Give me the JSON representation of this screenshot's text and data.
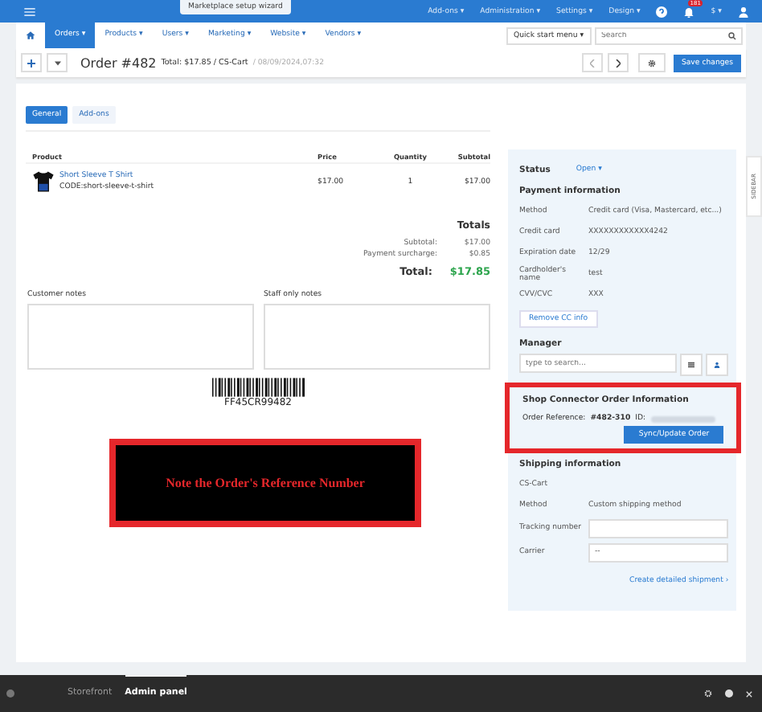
{
  "top_bar": {
    "wizard": "Marketplace setup wizard",
    "menus": [
      "Add-ons ▾",
      "Administration ▾",
      "Settings ▾",
      "Design ▾"
    ],
    "notifications": "181",
    "currency": "$ ▾"
  },
  "nav": {
    "items": [
      {
        "label": "Orders ▾",
        "selected": true
      },
      {
        "label": "Products ▾",
        "selected": false
      },
      {
        "label": "Users ▾",
        "selected": false
      },
      {
        "label": "Marketing ▾",
        "selected": false
      },
      {
        "label": "Website ▾",
        "selected": false
      },
      {
        "label": "Vendors ▾",
        "selected": false
      }
    ],
    "quick_menu": "Quick start menu ▾",
    "search": {
      "placeholder": "Search"
    }
  },
  "title": {
    "order": "Order #482",
    "total": "Total: $17.85 / CS-Cart",
    "date": "/ 08/09/2024,07:32",
    "save": "Save changes"
  },
  "tabs": [
    {
      "label": "General",
      "selected": true
    },
    {
      "label": "Add-ons",
      "selected": false
    }
  ],
  "table": {
    "columns": [
      "Product",
      "Price",
      "Quantity",
      "Subtotal"
    ],
    "rows": [
      {
        "name": "Short Sleeve T Shirt",
        "code": "CODE:short-sleeve-t-shirt",
        "price": "$17.00",
        "quantity": "1",
        "subtotal": "$17.00"
      }
    ]
  },
  "totals": {
    "title": "Totals",
    "rows": [
      {
        "label": "Subtotal:",
        "value": "$17.00"
      },
      {
        "label": "Payment surcharge:",
        "value": "$0.85"
      }
    ],
    "total_label": "Total:",
    "total_value": "$17.85"
  },
  "notes": [
    {
      "label": "Customer notes"
    },
    {
      "label": "Staff only notes"
    }
  ],
  "barcode": "FF45CR99482",
  "banner": "Note the Order's Reference Number",
  "side": {
    "status_label": "Status",
    "status": "Open ▾",
    "payment_title": "Payment information",
    "payment": [
      {
        "label": "Method",
        "value": "Credit card (Visa, Mastercard, etc...)"
      },
      {
        "label": "Credit card",
        "value": "XXXXXXXXXXXX4242"
      },
      {
        "label": "Expiration date",
        "value": "12/29"
      },
      {
        "label": "Cardholder's name",
        "value": "test"
      },
      {
        "label": "CVV/CVC",
        "value": "XXX"
      }
    ],
    "remove_cc": "Remove CC info",
    "manager_title": "Manager",
    "manager_placeholder": "type to search...",
    "connector": {
      "title": "Shop Connector Order Information",
      "ref_label": "Order Reference:",
      "ref_value": "#482-310",
      "id_label": "ID:",
      "button": "Sync/Update Order"
    },
    "shipping_title": "Shipping information",
    "shipping_company": "CS-Cart",
    "shipping_method_label": "Method",
    "shipping_method": "Custom shipping method",
    "tracking_label": "Tracking number",
    "carrier_label": "Carrier",
    "carrier_value": "--",
    "create_shipment": "Create detailed shipment ›"
  },
  "sidebar_tab": "SIDEBAR",
  "bottom_bar": {
    "tabs": [
      {
        "label": "Storefront",
        "selected": false
      },
      {
        "label": "Admin panel",
        "selected": true
      }
    ]
  }
}
